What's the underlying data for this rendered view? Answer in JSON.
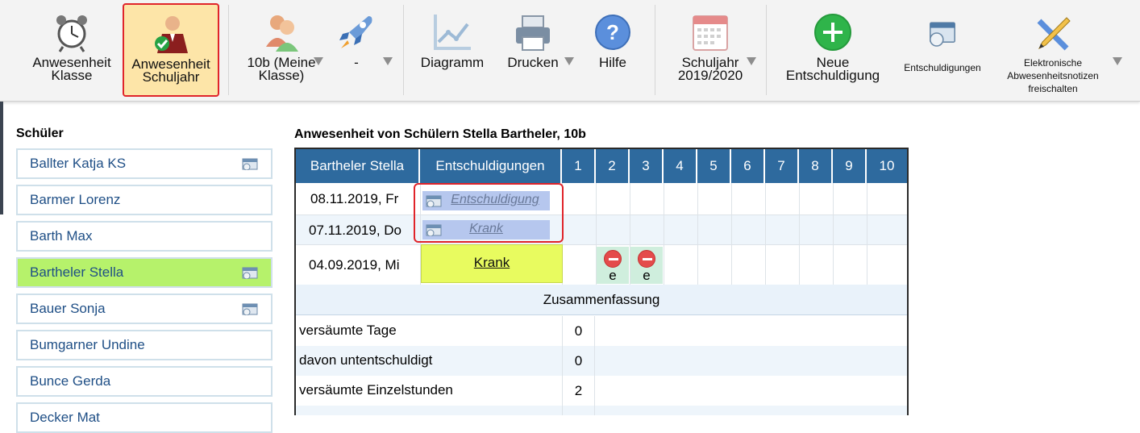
{
  "toolbar": {
    "attendance_class": "Anwesenheit Klasse",
    "attendance_year": "Anwesenheit Schuljahr",
    "class_select": "10b (Meine Klasse)",
    "dash_select": "-",
    "diagram": "Diagramm",
    "print": "Drucken",
    "help": "Hilfe",
    "school_year": "Schuljahr 2019/2020",
    "new_excuse": "Neue Entschuldigung",
    "excuses": "Entschuldigungen",
    "electronic_notes": "Elektronische Abwesenheitsnotizen freischalten"
  },
  "sidebar": {
    "title": "Schüler",
    "students": [
      {
        "name": "Ballter Katja KS",
        "has_icon": true
      },
      {
        "name": "Barmer Lorenz",
        "has_icon": false
      },
      {
        "name": "Barth Max",
        "has_icon": false
      },
      {
        "name": "Bartheler Stella",
        "has_icon": true,
        "selected": true
      },
      {
        "name": "Bauer Sonja",
        "has_icon": true
      },
      {
        "name": "Bumgarner Undine",
        "has_icon": false
      },
      {
        "name": "Bunce Gerda",
        "has_icon": false
      },
      {
        "name": "Decker Mat",
        "has_icon": false
      }
    ]
  },
  "main": {
    "title": "Anwesenheit von Schülern Stella Bartheler, 10b",
    "columns": [
      "Bartheler Stella",
      "Entschuldigungen",
      "1",
      "2",
      "3",
      "4",
      "5",
      "6",
      "7",
      "8",
      "9",
      "10"
    ],
    "rows": [
      {
        "date": "08.11.2019, Fr",
        "excuse": "Entschuldigung"
      },
      {
        "date": "07.11.2019, Do",
        "excuse": "Krank"
      },
      {
        "date": "04.09.2019, Mi",
        "excuse": "Krank",
        "absent_marks": [
          "e",
          "e"
        ]
      }
    ],
    "summary_title": "Zusammenfassung",
    "summary": [
      {
        "label": "versäumte Tage",
        "value": "0"
      },
      {
        "label": "davon untentschuldigt",
        "value": "0"
      },
      {
        "label": "versäumte Einzelstunden",
        "value": "2"
      }
    ]
  },
  "colors": {
    "header_blue": "#2e6a9e",
    "selected_student": "#b6f26b",
    "highlight_red": "#e0242a",
    "absence_green": "#cfeedd",
    "krank_yellow": "#e8fb5f"
  }
}
